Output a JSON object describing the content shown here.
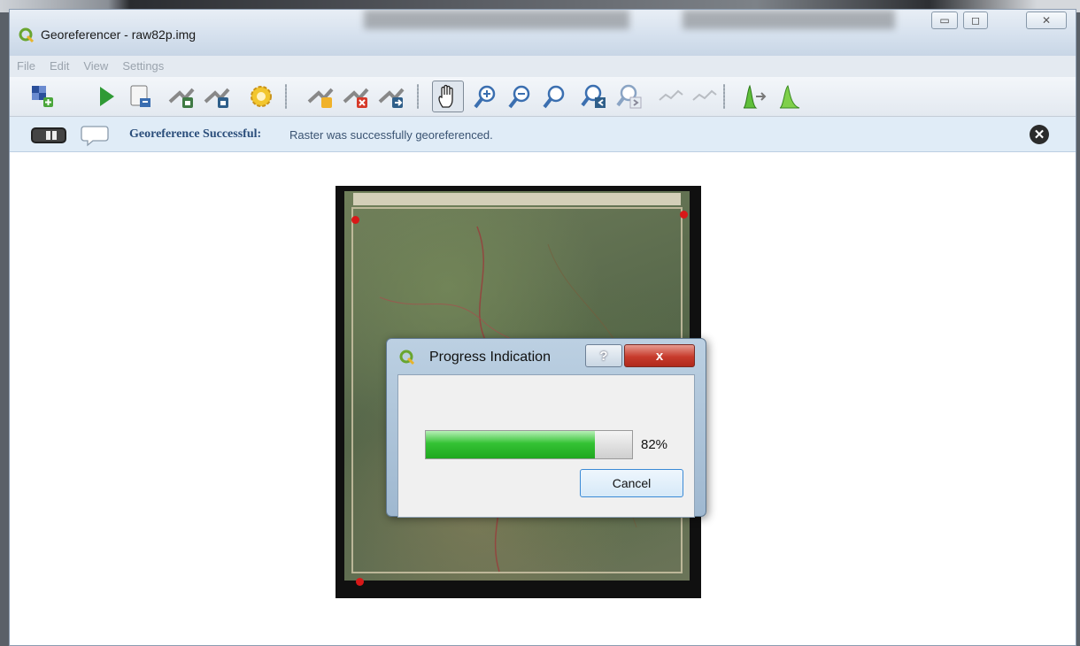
{
  "window": {
    "title": "Georeferencer - raw82p.img"
  },
  "menu": [
    "File",
    "Edit",
    "View",
    "Settings"
  ],
  "toolbar": [
    {
      "icon": "open-raster-icon"
    },
    {
      "icon": "start-georeferencing-icon"
    },
    {
      "icon": "generate-gdal-script-icon"
    },
    {
      "icon": "load-gcp-points-icon"
    },
    {
      "icon": "save-gcp-points-icon"
    },
    {
      "icon": "transformation-settings-icon"
    },
    {
      "icon": "add-point-icon"
    },
    {
      "icon": "delete-point-icon"
    },
    {
      "icon": "move-gcp-point-icon"
    },
    {
      "icon": "pan-icon"
    },
    {
      "icon": "zoom-in-icon"
    },
    {
      "icon": "zoom-out-icon"
    },
    {
      "icon": "zoom-to-layer-icon"
    },
    {
      "icon": "zoom-last-icon"
    },
    {
      "icon": "zoom-next-icon"
    },
    {
      "icon": "link-georeferencer-icon"
    },
    {
      "icon": "link-qgis-icon"
    },
    {
      "icon": "full-histogram-stretch-icon"
    },
    {
      "icon": "local-histogram-stretch-icon"
    }
  ],
  "message": {
    "title": "Georeference Successful:",
    "text": "Raster was successfully georeferenced."
  },
  "dialog": {
    "title": "Progress Indication",
    "help_label": "?",
    "close_label": "x",
    "progress": 0.82,
    "progress_label": "82%",
    "cancel_label": "Cancel"
  }
}
